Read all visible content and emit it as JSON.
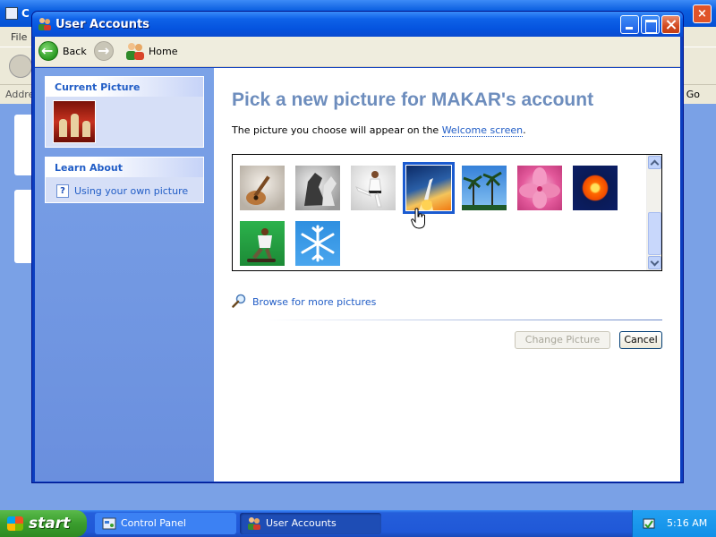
{
  "background_window": {
    "title_partial": "C",
    "menu_file": "File",
    "address_label": "Addre",
    "go_label": "Go"
  },
  "window": {
    "title": "User Accounts"
  },
  "toolbar": {
    "back_label": "Back",
    "home_label": "Home"
  },
  "sidebar": {
    "current_picture_header": "Current Picture",
    "learn_about_header": "Learn About",
    "learn_link": "Using your own picture"
  },
  "main": {
    "title": "Pick a new picture for MAKAR's account",
    "description_prefix": "The picture you choose will appear on the ",
    "description_link": "Welcome screen",
    "description_suffix": ".",
    "pictures": [
      {
        "name": "guitar",
        "icon": "guitar-picture"
      },
      {
        "name": "horses",
        "icon": "horse-picture"
      },
      {
        "name": "karate",
        "icon": "karate-picture"
      },
      {
        "name": "space-shuttle",
        "icon": "shuttle-picture",
        "selected": true
      },
      {
        "name": "palm-trees",
        "icon": "palm-picture"
      },
      {
        "name": "pink-flower",
        "icon": "flower-picture"
      },
      {
        "name": "orange-flower",
        "icon": "flower-picture"
      },
      {
        "name": "skateboarder",
        "icon": "skater-picture"
      },
      {
        "name": "snowflake",
        "icon": "snowflake-picture"
      }
    ],
    "browse_link": "Browse for more pictures",
    "change_button": "Change Picture",
    "cancel_button": "Cancel"
  },
  "taskbar": {
    "start_label": "start",
    "tasks": [
      {
        "label": "Control Panel"
      },
      {
        "label": "User Accounts",
        "active": true
      }
    ],
    "clock": "5:16 AM"
  },
  "colors": {
    "link": "#215dc6",
    "title_text": "#6d8dbd",
    "selection": "#1b5bd0",
    "titlebar": "#0553de"
  }
}
